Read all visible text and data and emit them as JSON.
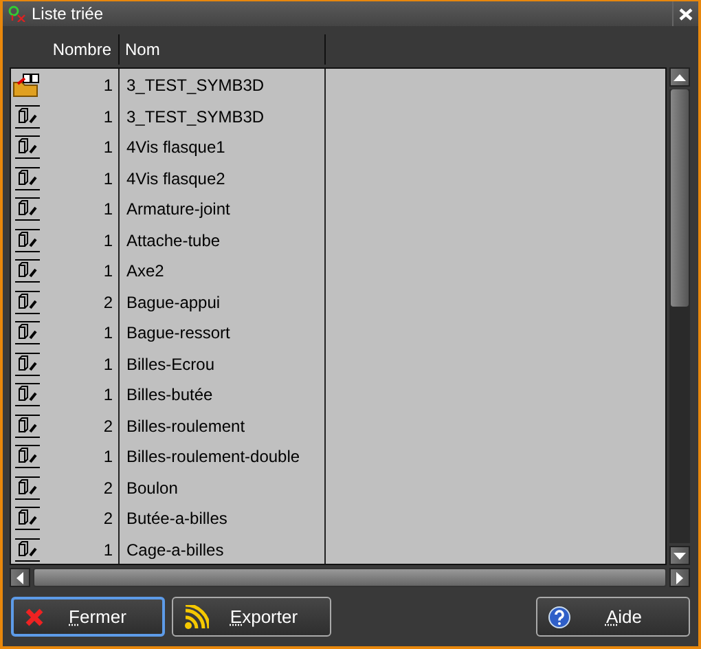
{
  "window": {
    "title": "Liste triée"
  },
  "table": {
    "columns": [
      "Nombre",
      "Nom"
    ],
    "rows": [
      {
        "kind": "assembly",
        "count": "1",
        "name": "3_TEST_SYMB3D"
      },
      {
        "kind": "part",
        "count": "1",
        "name": "3_TEST_SYMB3D"
      },
      {
        "kind": "part",
        "count": "1",
        "name": "4Vis flasque1"
      },
      {
        "kind": "part",
        "count": "1",
        "name": "4Vis flasque2"
      },
      {
        "kind": "part",
        "count": "1",
        "name": "Armature-joint"
      },
      {
        "kind": "part",
        "count": "1",
        "name": "Attache-tube"
      },
      {
        "kind": "part",
        "count": "1",
        "name": "Axe2"
      },
      {
        "kind": "part",
        "count": "2",
        "name": "Bague-appui"
      },
      {
        "kind": "part",
        "count": "1",
        "name": "Bague-ressort"
      },
      {
        "kind": "part",
        "count": "1",
        "name": "Billes-Ecrou"
      },
      {
        "kind": "part",
        "count": "1",
        "name": "Billes-butée"
      },
      {
        "kind": "part",
        "count": "2",
        "name": "Billes-roulement"
      },
      {
        "kind": "part",
        "count": "1",
        "name": "Billes-roulement-double"
      },
      {
        "kind": "part",
        "count": "2",
        "name": "Boulon"
      },
      {
        "kind": "part",
        "count": "2",
        "name": "Butée-a-billes"
      },
      {
        "kind": "part",
        "count": "1",
        "name": "Cage-a-billes"
      }
    ]
  },
  "buttons": [
    {
      "kind": "close",
      "label": "Fermer",
      "selected": true
    },
    {
      "kind": "export",
      "label": "Exporter",
      "selected": false
    },
    {
      "kind": "help",
      "label": "Aide",
      "selected": false
    }
  ]
}
